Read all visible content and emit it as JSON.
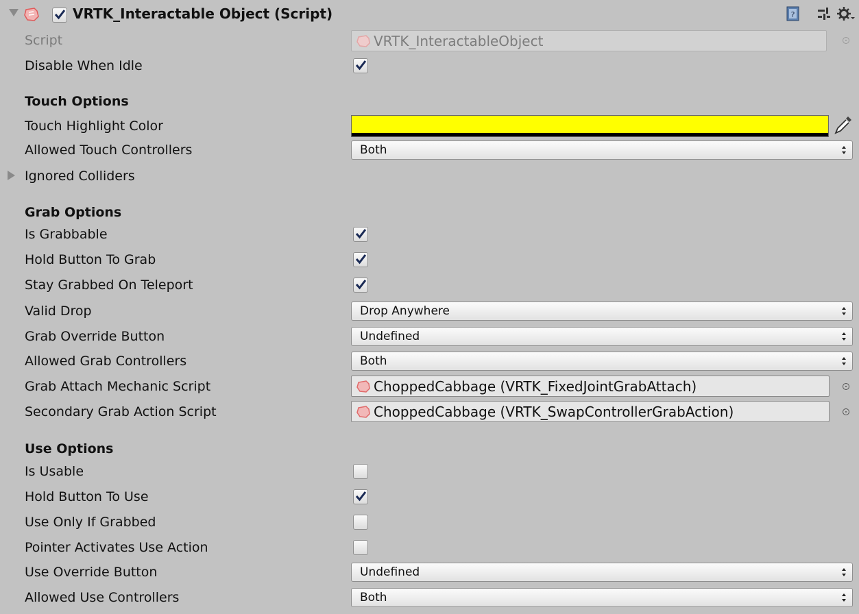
{
  "header": {
    "title": "VRTK_Interactable Object (Script)",
    "enabled": true,
    "icons": [
      "fold-arrow-icon",
      "script-icon",
      "checkbox-icon",
      "help-book-icon",
      "preset-sliders-icon",
      "gear-icon"
    ]
  },
  "script": {
    "label": "Script",
    "value": "VRTK_InteractableObject"
  },
  "disable_when_idle": {
    "label": "Disable When Idle",
    "checked": true
  },
  "touch": {
    "section_title": "Touch Options",
    "highlight_color": {
      "label": "Touch Highlight Color",
      "color": "#ffff00"
    },
    "allowed_controllers": {
      "label": "Allowed Touch Controllers",
      "value": "Both"
    },
    "ignored_colliders": {
      "label": "Ignored Colliders"
    }
  },
  "grab": {
    "section_title": "Grab Options",
    "is_grabbable": {
      "label": "Is Grabbable",
      "checked": true
    },
    "hold_button": {
      "label": "Hold Button To Grab",
      "checked": true
    },
    "stay_grabbed": {
      "label": "Stay Grabbed On Teleport",
      "checked": true
    },
    "valid_drop": {
      "label": "Valid Drop",
      "value": "Drop Anywhere"
    },
    "override_button": {
      "label": "Grab Override Button",
      "value": "Undefined"
    },
    "allowed_controllers": {
      "label": "Allowed Grab Controllers",
      "value": "Both"
    },
    "attach_script": {
      "label": "Grab Attach Mechanic Script",
      "value": "ChoppedCabbage (VRTK_FixedJointGrabAttach)"
    },
    "secondary_script": {
      "label": "Secondary Grab Action Script",
      "value": "ChoppedCabbage (VRTK_SwapControllerGrabAction)"
    }
  },
  "use": {
    "section_title": "Use Options",
    "is_usable": {
      "label": "Is Usable",
      "checked": false
    },
    "hold_button": {
      "label": "Hold Button To Use",
      "checked": true
    },
    "only_if_grabbed": {
      "label": "Use Only If Grabbed",
      "checked": false
    },
    "pointer_activates": {
      "label": "Pointer Activates Use Action",
      "checked": false
    },
    "override_button": {
      "label": "Use Override Button",
      "value": "Undefined"
    },
    "allowed_controllers": {
      "label": "Allowed Use Controllers",
      "value": "Both"
    }
  }
}
